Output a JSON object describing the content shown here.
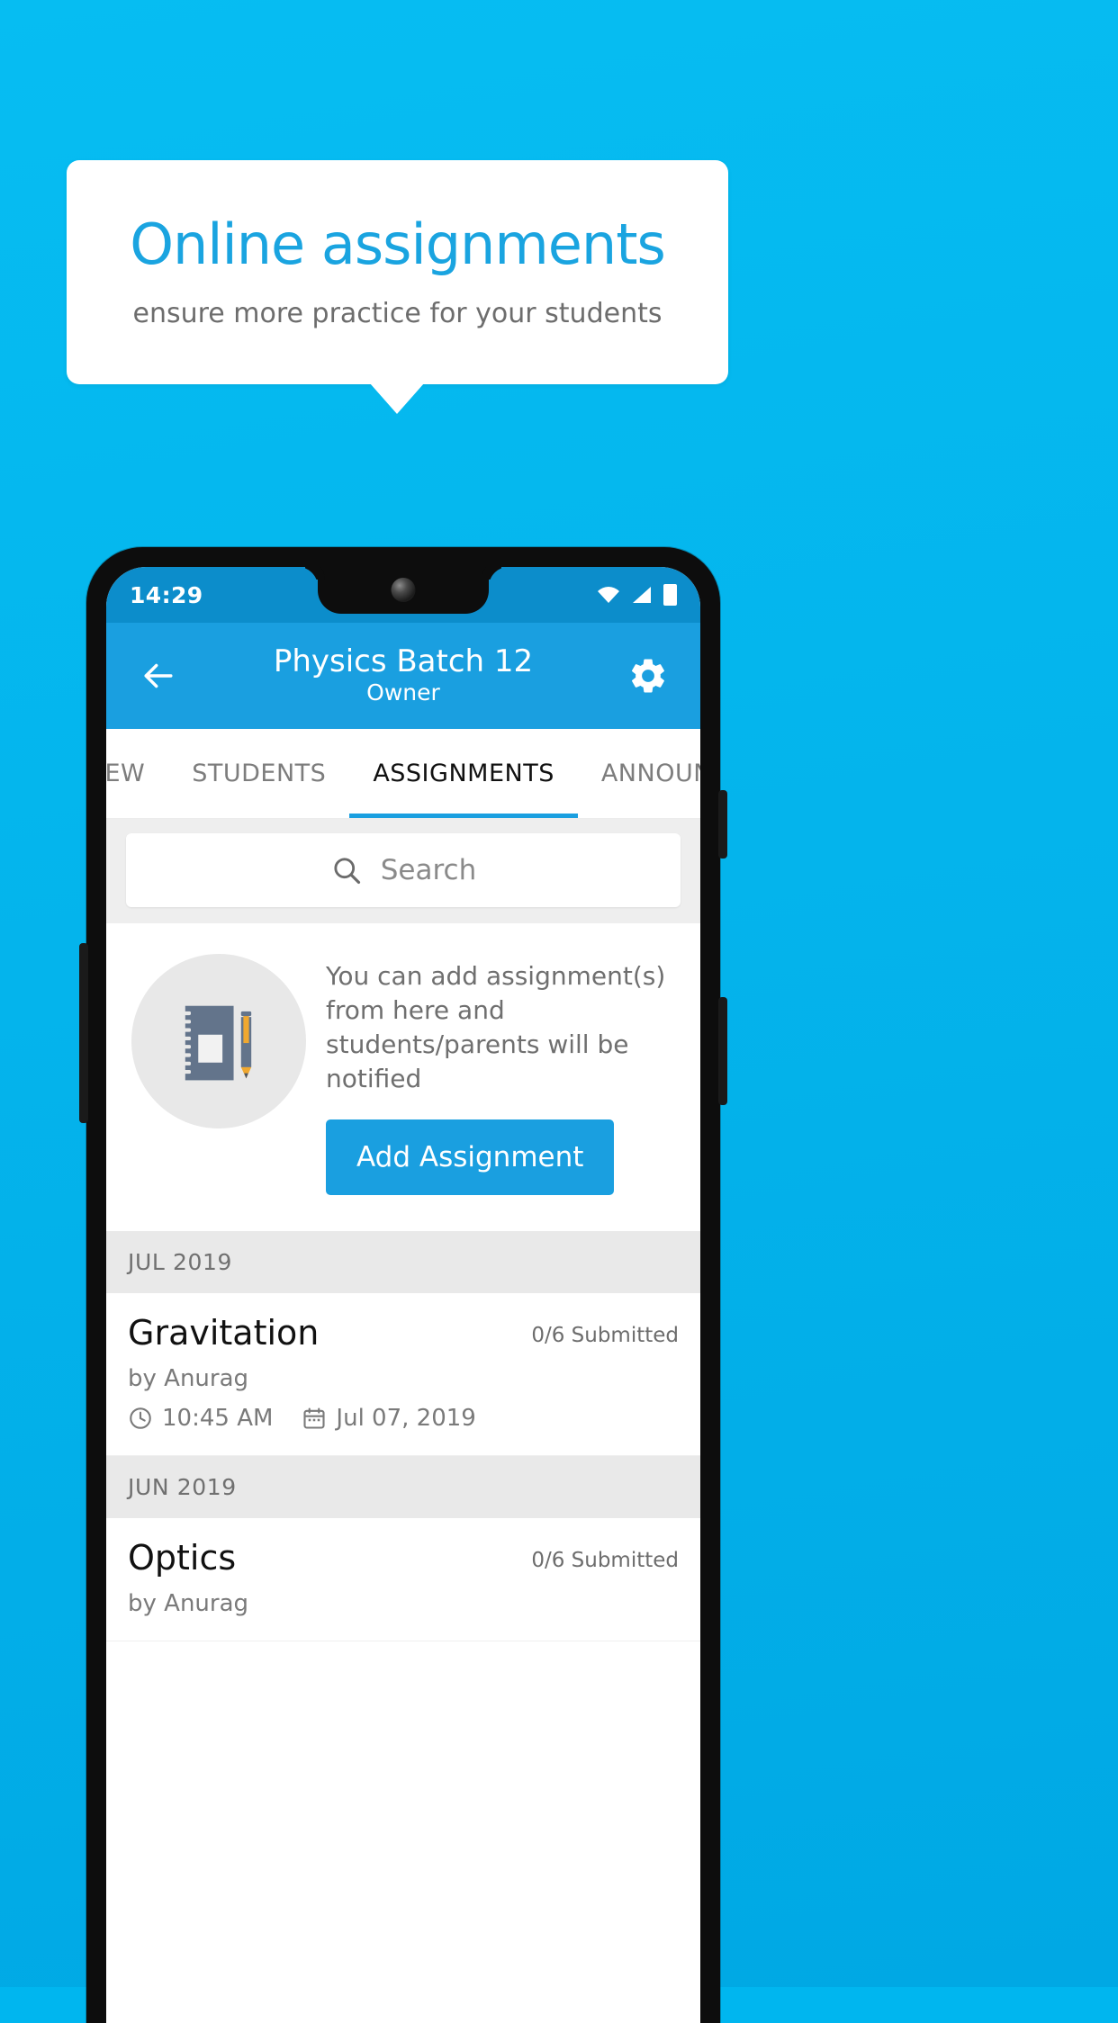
{
  "promo": {
    "title": "Online assignments",
    "subtitle": "ensure more practice for your students",
    "title_color": "#1aa4e0",
    "bg_color": "#03b5ee"
  },
  "phone": {
    "statusbar": {
      "time": "14:29",
      "icons": [
        "wifi-icon",
        "signal-icon",
        "battery-icon"
      ]
    },
    "appbar": {
      "back_icon": "arrow-left-icon",
      "title": "Physics Batch 12",
      "subtitle": "Owner",
      "settings_icon": "gear-icon",
      "color": "#1a9fe0"
    },
    "tabs": [
      {
        "label": "IEW",
        "active": false
      },
      {
        "label": "STUDENTS",
        "active": false
      },
      {
        "label": "ASSIGNMENTS",
        "active": true
      },
      {
        "label": "ANNOUNCEM",
        "active": false
      }
    ],
    "search": {
      "placeholder": "Search",
      "value": "",
      "icon": "search-icon"
    },
    "empty_state": {
      "illustration": "notebook-pencil-icon",
      "text": "You can add assignment(s) from here and students/parents will be notified",
      "button_label": "Add Assignment"
    },
    "groups": [
      {
        "month": "JUL 2019",
        "items": [
          {
            "name": "Gravitation",
            "submitted": "0/6 Submitted",
            "author": "by Anurag",
            "time": "10:45 AM",
            "date": "Jul 07, 2019",
            "time_icon": "clock-icon",
            "date_icon": "calendar-icon"
          }
        ]
      },
      {
        "month": "JUN 2019",
        "items": [
          {
            "name": "Optics",
            "submitted": "0/6 Submitted",
            "author": "by Anurag",
            "time": "",
            "date": "",
            "time_icon": "clock-icon",
            "date_icon": "calendar-icon"
          }
        ]
      }
    ]
  }
}
